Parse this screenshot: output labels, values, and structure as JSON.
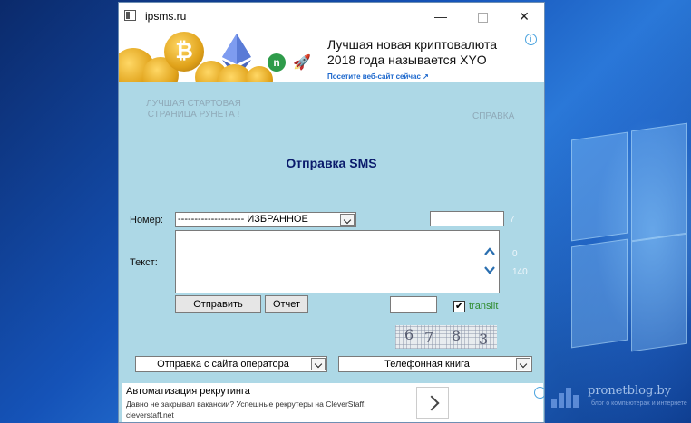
{
  "window": {
    "title": "ipsms.ru",
    "minimize": "—",
    "close": "✕"
  },
  "ad_banner": {
    "headline_line1": "Лучшая новая криптовалюта",
    "headline_line2": "2018 года называется XYO",
    "link": "Посетите веб-сайт сейчас ↗",
    "info": "i"
  },
  "nav": {
    "home": "ЛУЧШАЯ СТАРТОВАЯ СТРАНИЦА РУНЕТА !",
    "help": "СПРАВКА"
  },
  "page": {
    "heading": "Отправка SMS"
  },
  "form": {
    "number_label": "Номер:",
    "favorites_value": "-------------------- ИЗБРАННОЕ",
    "number_counter": "7",
    "text_label": "Текст:",
    "text_value": "",
    "chars_used": "0",
    "chars_max": "140",
    "send_button": "Отправить",
    "report_button": "Отчет",
    "translit_checked": "✔",
    "translit_label": "translit",
    "captcha_digits": [
      "6",
      "7",
      "8",
      "3"
    ]
  },
  "bottom_selects": {
    "operator_send": "Отправка с сайта оператора",
    "phonebook": "Телефонная книга"
  },
  "bottom_ad": {
    "title": "Автоматизация рекрутинга",
    "description": "Давно не закрывал вакансии? Успешные рекрутеры на CleverStaff.",
    "url": "cleverstaff.net",
    "info": "i"
  },
  "desktop_watermark": {
    "site": "pronetblog.by",
    "tagline": "блог о компьютерах и интернете"
  },
  "colors": {
    "page_bg": "#add8e6",
    "heading": "#0a1a6b",
    "translit": "#2e8b2e",
    "link": "#1a66cc"
  }
}
